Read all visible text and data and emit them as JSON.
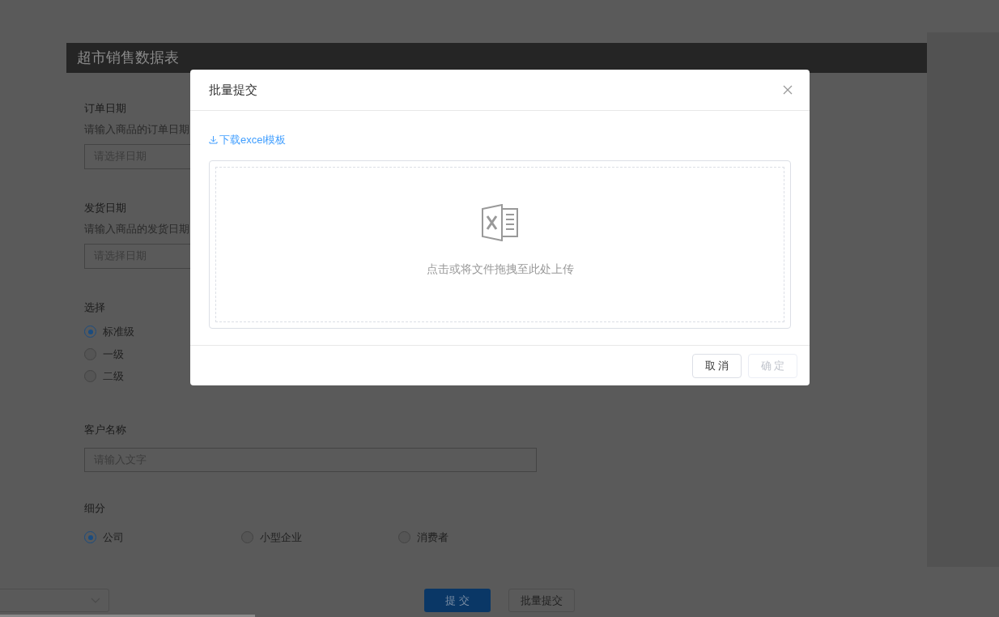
{
  "page": {
    "title": "超市销售数据表"
  },
  "form": [
    {
      "kind": "date",
      "label": "订单日期",
      "help": "请输入商品的订单日期",
      "placeholder": "请选择日期"
    },
    {
      "kind": "date",
      "label": "发货日期",
      "help": "请输入商品的发货日期",
      "placeholder": "请选择日期"
    },
    {
      "kind": "radio_list",
      "label": "选择",
      "options": [
        {
          "label": "标准级",
          "selected": true
        },
        {
          "label": "一级",
          "selected": false
        },
        {
          "label": "二级",
          "selected": false
        }
      ]
    },
    {
      "kind": "text",
      "label": "客户名称",
      "placeholder": "请输入文字"
    },
    {
      "kind": "radio_row",
      "label": "细分",
      "options": [
        {
          "label": "公司",
          "selected": true
        },
        {
          "label": "小型企业",
          "selected": false
        },
        {
          "label": "消费者",
          "selected": false
        }
      ]
    }
  ],
  "actions": [
    {
      "label": "提 交",
      "kind": "primary"
    },
    {
      "label": "批量提交",
      "kind": "default"
    }
  ],
  "dialog": {
    "title": "批量提交",
    "download_link": "下载excel模板",
    "upload_hint": "点击或将文件拖拽至此处上传",
    "buttons": [
      {
        "label": "取 消",
        "disabled": false
      },
      {
        "label": "确 定",
        "disabled": true
      }
    ]
  }
}
